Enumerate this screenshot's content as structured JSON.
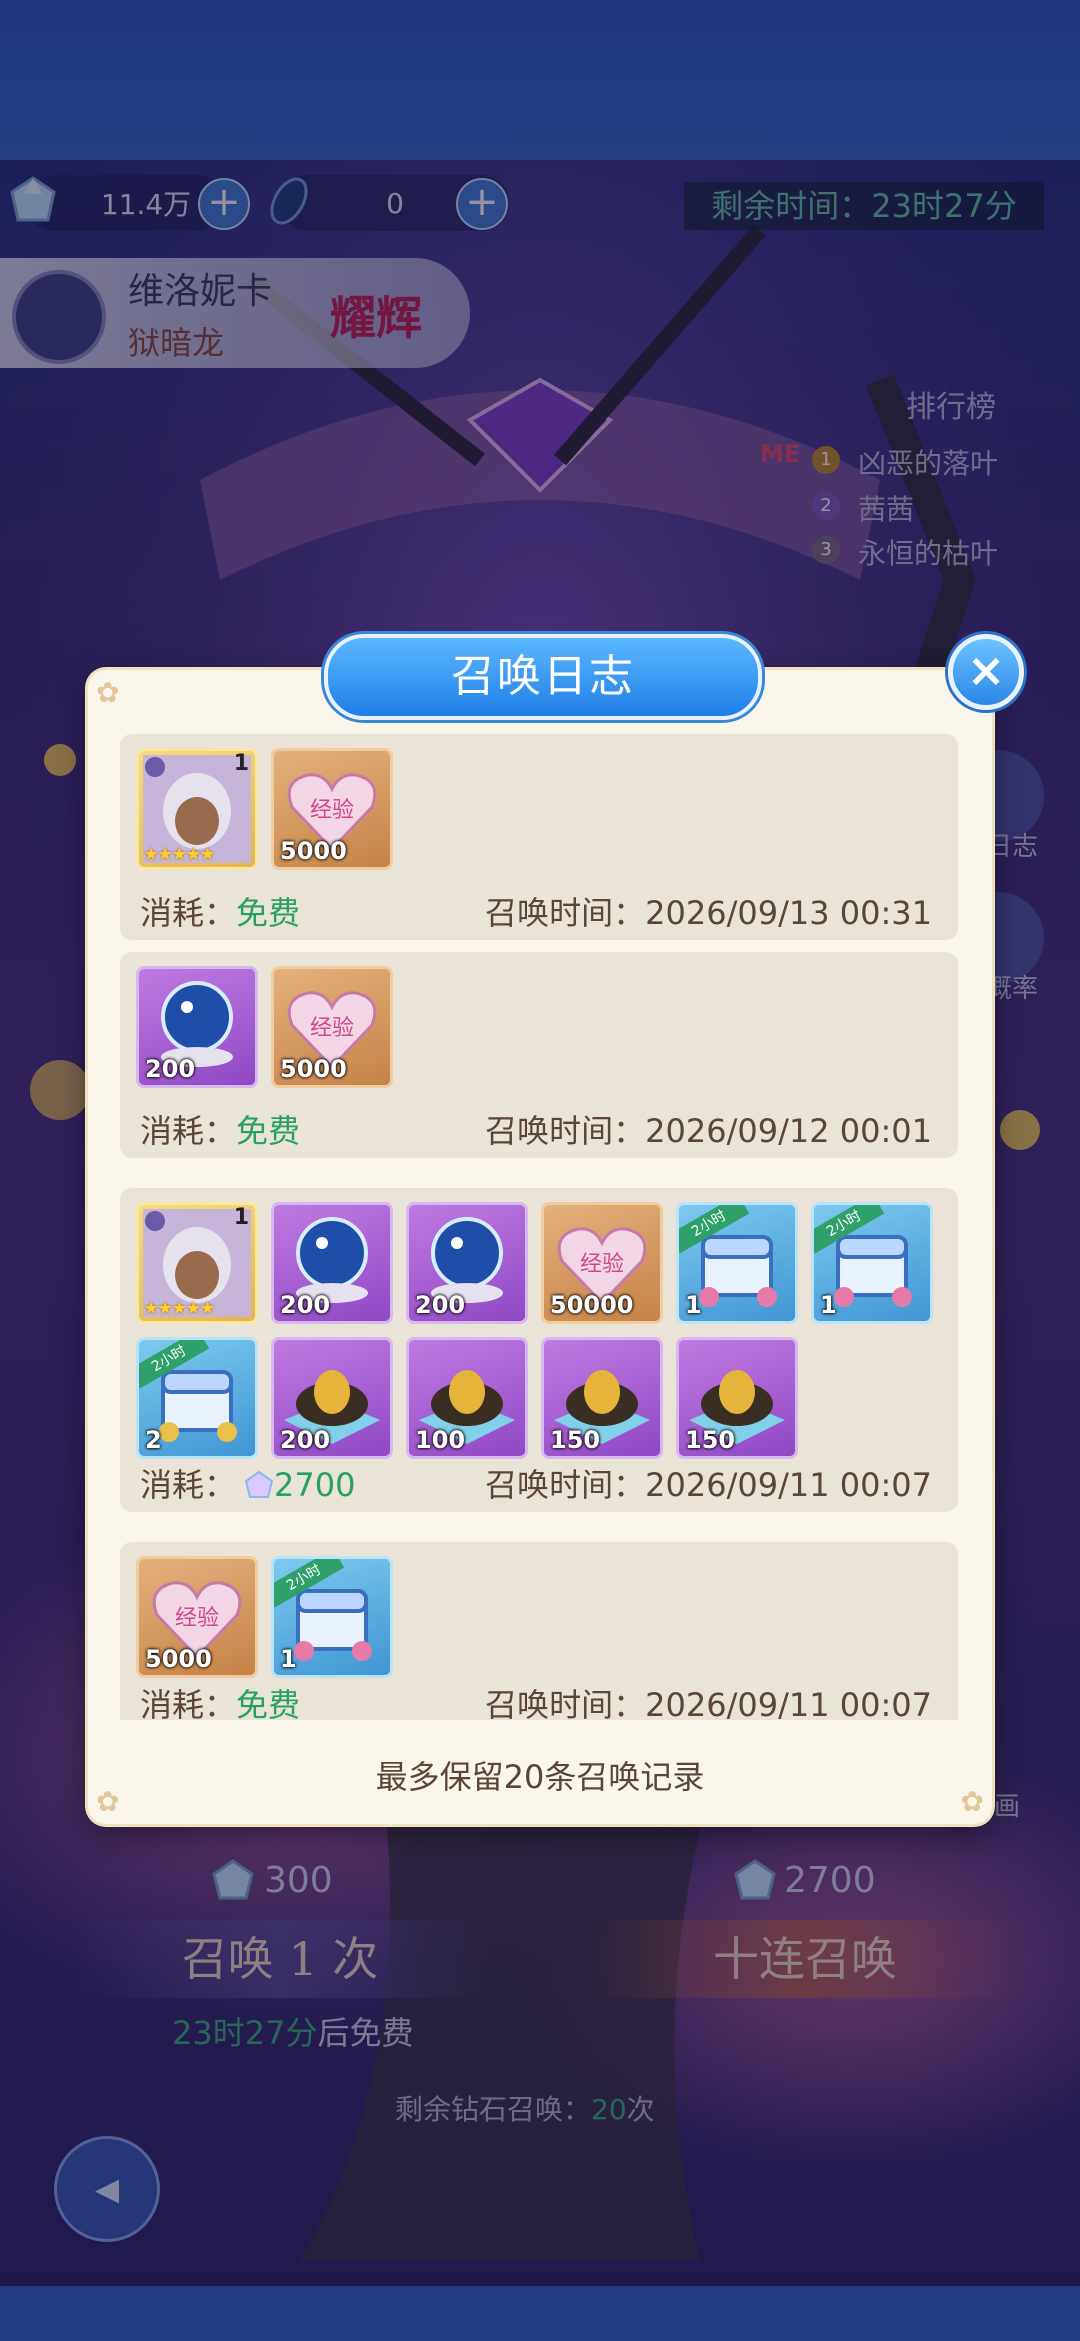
{
  "resources": {
    "gems": {
      "icon": "gem-icon",
      "value": "11.4万"
    },
    "shards": {
      "icon": "crystal-icon",
      "value": "0"
    },
    "add_label": "+"
  },
  "timer": {
    "label": "剩余时间：",
    "value": "23时27分"
  },
  "hero": {
    "name": "维洛妮卡",
    "subtitle": "狱暗龙",
    "rarity": "耀辉"
  },
  "ranking": {
    "title": "排行榜",
    "me_label": "ME",
    "entries": [
      {
        "rank": "1",
        "name": "凶恶的落叶"
      },
      {
        "rank": "2",
        "name": "茜茜"
      },
      {
        "rank": "3",
        "name": "永恒的枯叶"
      }
    ]
  },
  "side": {
    "log_label": "日志",
    "rate_label": "概率",
    "anim_label": "画"
  },
  "dialog": {
    "title": "召唤日志",
    "close": "×",
    "cost_label": "消耗：",
    "time_label": "召唤时间：",
    "entries": [
      {
        "cost": "免费",
        "time": "2026/09/13 00:31",
        "items": [
          {
            "type": "hero-card",
            "qty": "1"
          },
          {
            "type": "exp-heart",
            "qty": "5000"
          }
        ]
      },
      {
        "cost": "免费",
        "time": "2026/09/12 00:01",
        "items": [
          {
            "type": "star-orb",
            "qty": "200"
          },
          {
            "type": "exp-heart",
            "qty": "5000"
          }
        ]
      },
      {
        "cost": "2700",
        "time": "2026/09/11 00:07",
        "items": [
          {
            "type": "hero-card",
            "qty": "1"
          },
          {
            "type": "star-orb",
            "qty": "200"
          },
          {
            "type": "star-orb",
            "qty": "200"
          },
          {
            "type": "exp-heart",
            "qty": "50000"
          },
          {
            "type": "chest",
            "qty": "1",
            "ribbon": "2小时"
          },
          {
            "type": "chest",
            "qty": "1",
            "ribbon": "2小时"
          },
          {
            "type": "gold-chest",
            "qty": "2",
            "ribbon": "2小时"
          },
          {
            "type": "gold-egg",
            "qty": "200"
          },
          {
            "type": "gold-egg",
            "qty": "100"
          },
          {
            "type": "gold-egg",
            "qty": "150"
          },
          {
            "type": "gold-egg",
            "qty": "150"
          }
        ]
      },
      {
        "cost": "免费",
        "time": "2026/09/11 00:07",
        "items": [
          {
            "type": "exp-heart",
            "qty": "5000"
          },
          {
            "type": "chest",
            "qty": "1",
            "ribbon": "2小时"
          }
        ]
      }
    ],
    "footer": "最多保留20条召唤记录"
  },
  "summon": {
    "single": {
      "cost": "300",
      "label": "召唤 1 次"
    },
    "ten": {
      "cost": "2700",
      "label": "十连召唤"
    },
    "free_time": "23时27分",
    "free_suffix": "后免费",
    "remain_prefix": "剩余钻石召唤：",
    "remain_count": "20",
    "remain_suffix": "次"
  },
  "back_label": "◂"
}
